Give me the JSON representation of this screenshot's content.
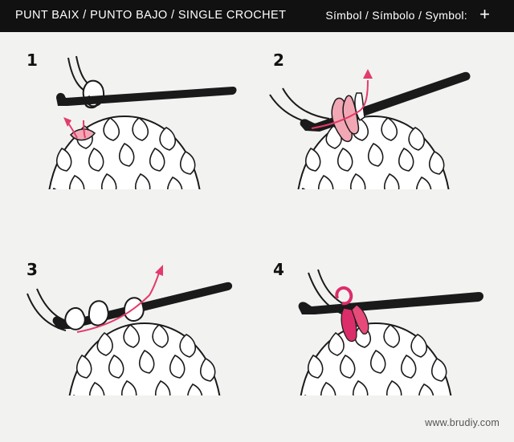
{
  "header": {
    "title": "PUNT BAIX / PUNTO BAJO / SINGLE CROCHET",
    "symbol_label": "Símbol / Símbolo / Symbol:",
    "symbol_glyph": "+"
  },
  "steps": [
    {
      "number": "1"
    },
    {
      "number": "2"
    },
    {
      "number": "3"
    },
    {
      "number": "4"
    }
  ],
  "footer": {
    "url": "www.brudiy.com"
  },
  "colors": {
    "header_bg": "#111111",
    "background": "#f2f2f1",
    "hook": "#1a1a1a",
    "yarn_light_pink": "#f2a7b5",
    "yarn_pink": "#e64b7a",
    "yarn_dark_pink": "#db2d6a",
    "arrow": "#e23c6b"
  }
}
